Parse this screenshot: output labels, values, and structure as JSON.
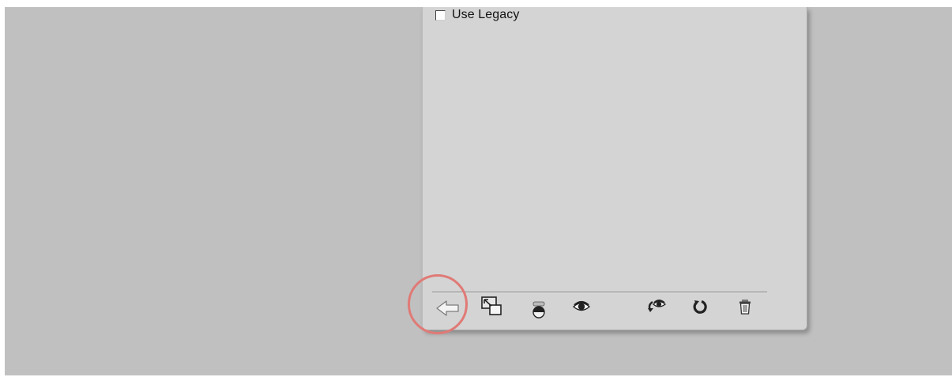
{
  "panel": {
    "legacy_checkbox": {
      "label": "Use Legacy",
      "checked": false
    }
  },
  "toolbar": {
    "buttons": [
      {
        "name": "return-to-adjustment-list-button",
        "icon": "left-arrow-icon"
      },
      {
        "name": "expand-view-button",
        "icon": "expand-view-icon"
      },
      {
        "name": "clip-to-layer-button",
        "icon": "clip-to-layer-icon"
      },
      {
        "name": "toggle-visibility-button",
        "icon": "eye-icon"
      },
      {
        "name": "view-previous-state-button",
        "icon": "previous-state-eye-icon"
      },
      {
        "name": "reset-button",
        "icon": "reset-icon"
      },
      {
        "name": "delete-button",
        "icon": "trash-icon"
      }
    ]
  },
  "annotation": {
    "highlight_color": "#e07a76"
  },
  "colors": {
    "background": "#c0c0c0",
    "panel": "#d4d4d4"
  }
}
